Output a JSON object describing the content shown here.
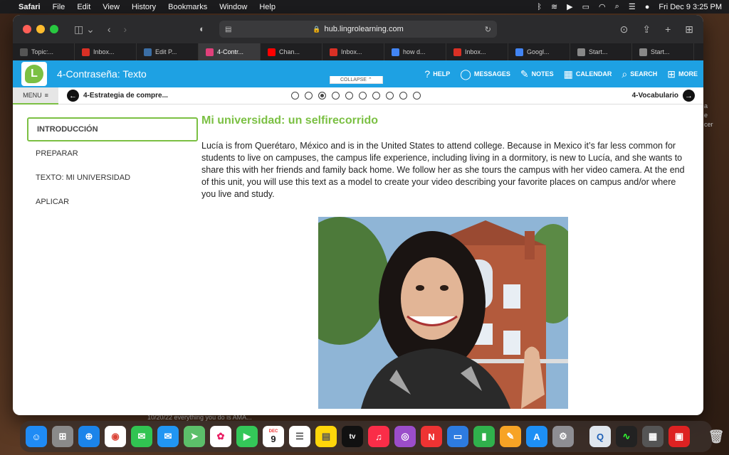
{
  "menubar": {
    "app": "Safari",
    "items": [
      "File",
      "Edit",
      "View",
      "History",
      "Bookmarks",
      "Window",
      "Help"
    ],
    "clock": "Fri Dec 9  3:25 PM"
  },
  "browser": {
    "url": "hub.lingrolearning.com",
    "tabs": [
      {
        "label": "Topic:...",
        "icon": "crown-icon",
        "color": "#555"
      },
      {
        "label": "Inbox...",
        "icon": "gmail-icon",
        "color": "#d93025"
      },
      {
        "label": "Edit P...",
        "icon": "edit-icon",
        "color": "#3b6ea5"
      },
      {
        "label": "4-Contr...",
        "icon": "puzzle-icon",
        "color": "#e0407a"
      },
      {
        "label": "Chan...",
        "icon": "youtube-icon",
        "color": "#ff0000"
      },
      {
        "label": "Inbox...",
        "icon": "gmail-icon",
        "color": "#d93025"
      },
      {
        "label": "how d...",
        "icon": "google-icon",
        "color": "#4285f4"
      },
      {
        "label": "Inbox...",
        "icon": "gmail-icon",
        "color": "#d93025"
      },
      {
        "label": "Googl...",
        "icon": "docs-icon",
        "color": "#4285f4"
      },
      {
        "label": "Start...",
        "icon": "star-icon",
        "color": "#888"
      },
      {
        "label": "Start...",
        "icon": "star-icon",
        "color": "#888"
      }
    ]
  },
  "header": {
    "title": "4-Contraseña: Texto",
    "logo_letter": "L",
    "nav": [
      {
        "label": "HELP",
        "glyph": "?"
      },
      {
        "label": "MESSAGES",
        "glyph": "💬"
      },
      {
        "label": "NOTES",
        "glyph": "✎"
      },
      {
        "label": "CALENDAR",
        "glyph": "▦"
      },
      {
        "label": "SEARCH",
        "glyph": "🔍"
      },
      {
        "label": "MORE",
        "glyph": "▦"
      }
    ]
  },
  "subnav": {
    "menu_label": "MENU",
    "prev_label": "4-Estrategia de compre...",
    "next_label": "4-Vocabulario",
    "collapse_label": "COLLAPSE",
    "dots_total": 10,
    "dots_active": 3
  },
  "sidebar": {
    "items": [
      {
        "label": "INTRODUCCIÓN",
        "active": true
      },
      {
        "label": "PREPARAR",
        "active": false
      },
      {
        "label": "TEXTO: MI UNIVERSIDAD",
        "active": false
      },
      {
        "label": "APLICAR",
        "active": false
      }
    ]
  },
  "main": {
    "heading": "Mi universidad: un selfirecorrido",
    "body": "Lucía is from Querétaro, México and is in the United States to attend college. Because in Mexico it’s far less common for students to live on campuses, the campus life experience, including living in a dormitory, is new to Lucía, and she wants to share this with her friends and family back home. We follow her as she tours the campus with her video camera. At the end of this unit, you will use this text as a model to create your video describing your favorite places on campus and/or where you live and study."
  },
  "background": {
    "snippet": "10/20/22  everything you do is AMA...",
    "side_fragment_1": "a",
    "side_fragment_2": "e",
    "side_fragment_3": "cer"
  },
  "dock": {
    "calendar_month": "DEC",
    "calendar_day": "9",
    "tv_label": "tv"
  },
  "colors": {
    "header_blue": "#1ea1e3",
    "accent_green": "#7bc043"
  }
}
